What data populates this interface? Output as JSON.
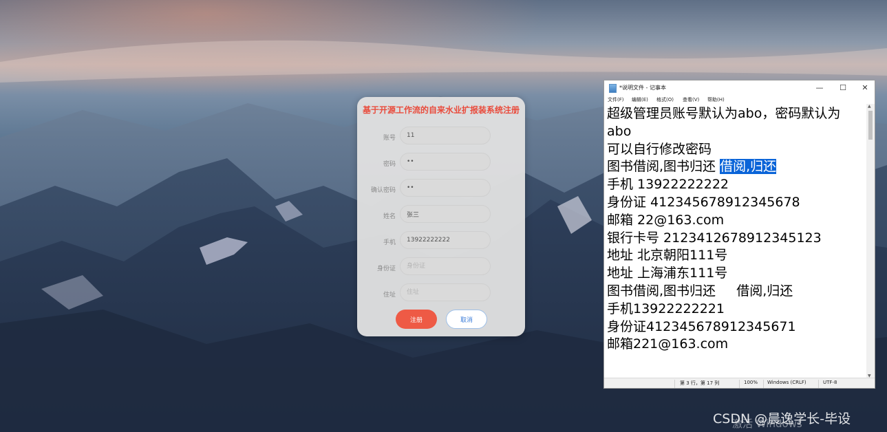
{
  "register_form": {
    "title": "基于开源工作流的自来水业扩报装系统注册",
    "fields": [
      {
        "label": "账号",
        "value": "11",
        "placeholder": ""
      },
      {
        "label": "密码",
        "value": "••",
        "placeholder": ""
      },
      {
        "label": "确认密码",
        "value": "••",
        "placeholder": ""
      },
      {
        "label": "姓名",
        "value": "张三",
        "placeholder": ""
      },
      {
        "label": "手机",
        "value": "13922222222",
        "placeholder": ""
      },
      {
        "label": "身份证",
        "value": "",
        "placeholder": "身份证"
      },
      {
        "label": "住址",
        "value": "",
        "placeholder": "住址"
      }
    ],
    "register_label": "注册",
    "cancel_label": "取消"
  },
  "notepad": {
    "title": "*说明文件 - 记事本",
    "window_controls": {
      "minimize": "—",
      "maximize": "☐",
      "close": "✕"
    },
    "menu": [
      "文件(F)",
      "编辑(E)",
      "格式(O)",
      "查看(V)",
      "帮助(H)"
    ],
    "lines": [
      {
        "text": "超级管理员账号默认为abo，密码默认为"
      },
      {
        "text": "abo"
      },
      {
        "text": "可以自行修改密码"
      },
      {
        "text": "图书借阅,图书归还 ",
        "selected": "借阅,归还"
      },
      {
        "text": "手机 13922222222"
      },
      {
        "text": "身份证 412345678912345678"
      },
      {
        "text": "邮箱 22@163.com"
      },
      {
        "text": "银行卡号 2123412678912345123"
      },
      {
        "text": "地址 北京朝阳111号"
      },
      {
        "text": "地址 上海浦东111号"
      },
      {
        "text": "图书借阅,图书归还     借阅,归还"
      },
      {
        "text": "手机13922222221"
      },
      {
        "text": "身份证412345678912345671"
      },
      {
        "text": "邮箱221@163.com"
      }
    ],
    "status": {
      "position": "第 3 行，第 17 列",
      "zoom": "100%",
      "line_ending": "Windows (CRLF)",
      "encoding": "UTF-8"
    },
    "selection_color": "#0a64d8"
  },
  "watermark": "CSDN @晨逸学长-毕设",
  "activate_windows": "激活 Windows"
}
